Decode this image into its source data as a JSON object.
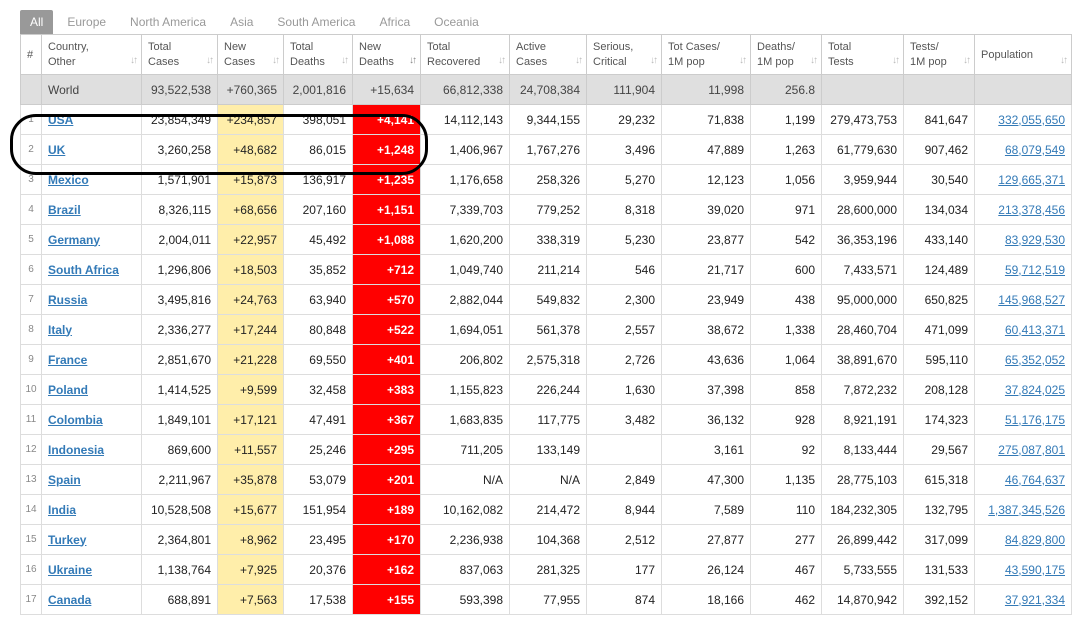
{
  "tabs": [
    "All",
    "Europe",
    "North America",
    "Asia",
    "South America",
    "Africa",
    "Oceania"
  ],
  "active_tab": 0,
  "headers": [
    {
      "l1": "#",
      "l2": ""
    },
    {
      "l1": "Country,",
      "l2": "Other"
    },
    {
      "l1": "Total",
      "l2": "Cases"
    },
    {
      "l1": "New",
      "l2": "Cases"
    },
    {
      "l1": "Total",
      "l2": "Deaths"
    },
    {
      "l1": "New",
      "l2": "Deaths"
    },
    {
      "l1": "Total",
      "l2": "Recovered"
    },
    {
      "l1": "Active",
      "l2": "Cases"
    },
    {
      "l1": "Serious,",
      "l2": "Critical"
    },
    {
      "l1": "Tot Cases/",
      "l2": "1M pop"
    },
    {
      "l1": "Deaths/",
      "l2": "1M pop"
    },
    {
      "l1": "Total",
      "l2": "Tests"
    },
    {
      "l1": "Tests/",
      "l2": "1M pop"
    },
    {
      "l1": "Population",
      "l2": ""
    }
  ],
  "world": {
    "country": "World",
    "total_cases": "93,522,538",
    "new_cases": "+760,365",
    "total_deaths": "2,001,816",
    "new_deaths": "+15,634",
    "total_recovered": "66,812,338",
    "active_cases": "24,708,384",
    "serious": "111,904",
    "cases_per_m": "11,998",
    "deaths_per_m": "256.8",
    "total_tests": "",
    "tests_per_m": "",
    "population": ""
  },
  "rows": [
    {
      "rank": "1",
      "country": "USA",
      "total_cases": "23,854,349",
      "new_cases": "+234,857",
      "total_deaths": "398,051",
      "new_deaths": "+4,141",
      "total_recovered": "14,112,143",
      "active_cases": "9,344,155",
      "serious": "29,232",
      "cases_per_m": "71,838",
      "deaths_per_m": "1,199",
      "total_tests": "279,473,753",
      "tests_per_m": "841,647",
      "population": "332,055,650"
    },
    {
      "rank": "2",
      "country": "UK",
      "total_cases": "3,260,258",
      "new_cases": "+48,682",
      "total_deaths": "86,015",
      "new_deaths": "+1,248",
      "total_recovered": "1,406,967",
      "active_cases": "1,767,276",
      "serious": "3,496",
      "cases_per_m": "47,889",
      "deaths_per_m": "1,263",
      "total_tests": "61,779,630",
      "tests_per_m": "907,462",
      "population": "68,079,549"
    },
    {
      "rank": "3",
      "country": "Mexico",
      "total_cases": "1,571,901",
      "new_cases": "+15,873",
      "total_deaths": "136,917",
      "new_deaths": "+1,235",
      "total_recovered": "1,176,658",
      "active_cases": "258,326",
      "serious": "5,270",
      "cases_per_m": "12,123",
      "deaths_per_m": "1,056",
      "total_tests": "3,959,944",
      "tests_per_m": "30,540",
      "population": "129,665,371"
    },
    {
      "rank": "4",
      "country": "Brazil",
      "total_cases": "8,326,115",
      "new_cases": "+68,656",
      "total_deaths": "207,160",
      "new_deaths": "+1,151",
      "total_recovered": "7,339,703",
      "active_cases": "779,252",
      "serious": "8,318",
      "cases_per_m": "39,020",
      "deaths_per_m": "971",
      "total_tests": "28,600,000",
      "tests_per_m": "134,034",
      "population": "213,378,456"
    },
    {
      "rank": "5",
      "country": "Germany",
      "total_cases": "2,004,011",
      "new_cases": "+22,957",
      "total_deaths": "45,492",
      "new_deaths": "+1,088",
      "total_recovered": "1,620,200",
      "active_cases": "338,319",
      "serious": "5,230",
      "cases_per_m": "23,877",
      "deaths_per_m": "542",
      "total_tests": "36,353,196",
      "tests_per_m": "433,140",
      "population": "83,929,530"
    },
    {
      "rank": "6",
      "country": "South Africa",
      "total_cases": "1,296,806",
      "new_cases": "+18,503",
      "total_deaths": "35,852",
      "new_deaths": "+712",
      "total_recovered": "1,049,740",
      "active_cases": "211,214",
      "serious": "546",
      "cases_per_m": "21,717",
      "deaths_per_m": "600",
      "total_tests": "7,433,571",
      "tests_per_m": "124,489",
      "population": "59,712,519"
    },
    {
      "rank": "7",
      "country": "Russia",
      "total_cases": "3,495,816",
      "new_cases": "+24,763",
      "total_deaths": "63,940",
      "new_deaths": "+570",
      "total_recovered": "2,882,044",
      "active_cases": "549,832",
      "serious": "2,300",
      "cases_per_m": "23,949",
      "deaths_per_m": "438",
      "total_tests": "95,000,000",
      "tests_per_m": "650,825",
      "population": "145,968,527"
    },
    {
      "rank": "8",
      "country": "Italy",
      "total_cases": "2,336,277",
      "new_cases": "+17,244",
      "total_deaths": "80,848",
      "new_deaths": "+522",
      "total_recovered": "1,694,051",
      "active_cases": "561,378",
      "serious": "2,557",
      "cases_per_m": "38,672",
      "deaths_per_m": "1,338",
      "total_tests": "28,460,704",
      "tests_per_m": "471,099",
      "population": "60,413,371"
    },
    {
      "rank": "9",
      "country": "France",
      "total_cases": "2,851,670",
      "new_cases": "+21,228",
      "total_deaths": "69,550",
      "new_deaths": "+401",
      "total_recovered": "206,802",
      "active_cases": "2,575,318",
      "serious": "2,726",
      "cases_per_m": "43,636",
      "deaths_per_m": "1,064",
      "total_tests": "38,891,670",
      "tests_per_m": "595,110",
      "population": "65,352,052"
    },
    {
      "rank": "10",
      "country": "Poland",
      "total_cases": "1,414,525",
      "new_cases": "+9,599",
      "total_deaths": "32,458",
      "new_deaths": "+383",
      "total_recovered": "1,155,823",
      "active_cases": "226,244",
      "serious": "1,630",
      "cases_per_m": "37,398",
      "deaths_per_m": "858",
      "total_tests": "7,872,232",
      "tests_per_m": "208,128",
      "population": "37,824,025"
    },
    {
      "rank": "11",
      "country": "Colombia",
      "total_cases": "1,849,101",
      "new_cases": "+17,121",
      "total_deaths": "47,491",
      "new_deaths": "+367",
      "total_recovered": "1,683,835",
      "active_cases": "117,775",
      "serious": "3,482",
      "cases_per_m": "36,132",
      "deaths_per_m": "928",
      "total_tests": "8,921,191",
      "tests_per_m": "174,323",
      "population": "51,176,175"
    },
    {
      "rank": "12",
      "country": "Indonesia",
      "total_cases": "869,600",
      "new_cases": "+11,557",
      "total_deaths": "25,246",
      "new_deaths": "+295",
      "total_recovered": "711,205",
      "active_cases": "133,149",
      "serious": "",
      "cases_per_m": "3,161",
      "deaths_per_m": "92",
      "total_tests": "8,133,444",
      "tests_per_m": "29,567",
      "population": "275,087,801"
    },
    {
      "rank": "13",
      "country": "Spain",
      "total_cases": "2,211,967",
      "new_cases": "+35,878",
      "total_deaths": "53,079",
      "new_deaths": "+201",
      "total_recovered": "N/A",
      "active_cases": "N/A",
      "serious": "2,849",
      "cases_per_m": "47,300",
      "deaths_per_m": "1,135",
      "total_tests": "28,775,103",
      "tests_per_m": "615,318",
      "population": "46,764,637"
    },
    {
      "rank": "14",
      "country": "India",
      "total_cases": "10,528,508",
      "new_cases": "+15,677",
      "total_deaths": "151,954",
      "new_deaths": "+189",
      "total_recovered": "10,162,082",
      "active_cases": "214,472",
      "serious": "8,944",
      "cases_per_m": "7,589",
      "deaths_per_m": "110",
      "total_tests": "184,232,305",
      "tests_per_m": "132,795",
      "population": "1,387,345,526"
    },
    {
      "rank": "15",
      "country": "Turkey",
      "total_cases": "2,364,801",
      "new_cases": "+8,962",
      "total_deaths": "23,495",
      "new_deaths": "+170",
      "total_recovered": "2,236,938",
      "active_cases": "104,368",
      "serious": "2,512",
      "cases_per_m": "27,877",
      "deaths_per_m": "277",
      "total_tests": "26,899,442",
      "tests_per_m": "317,099",
      "population": "84,829,800"
    },
    {
      "rank": "16",
      "country": "Ukraine",
      "total_cases": "1,138,764",
      "new_cases": "+7,925",
      "total_deaths": "20,376",
      "new_deaths": "+162",
      "total_recovered": "837,063",
      "active_cases": "281,325",
      "serious": "177",
      "cases_per_m": "26,124",
      "deaths_per_m": "467",
      "total_tests": "5,733,555",
      "tests_per_m": "131,533",
      "population": "43,590,175"
    },
    {
      "rank": "17",
      "country": "Canada",
      "total_cases": "688,891",
      "new_cases": "+7,563",
      "total_deaths": "17,538",
      "new_deaths": "+155",
      "total_recovered": "593,398",
      "active_cases": "77,955",
      "serious": "874",
      "cases_per_m": "18,166",
      "deaths_per_m": "462",
      "total_tests": "14,870,942",
      "tests_per_m": "392,152",
      "population": "37,921,334"
    }
  ],
  "colors": {
    "new_cases_bg": "#FFEEAA",
    "new_deaths_bg": "#FF0000",
    "link": "#337AB7",
    "world_row_bg": "#DFDFDF",
    "active_tab_bg": "#999999"
  }
}
